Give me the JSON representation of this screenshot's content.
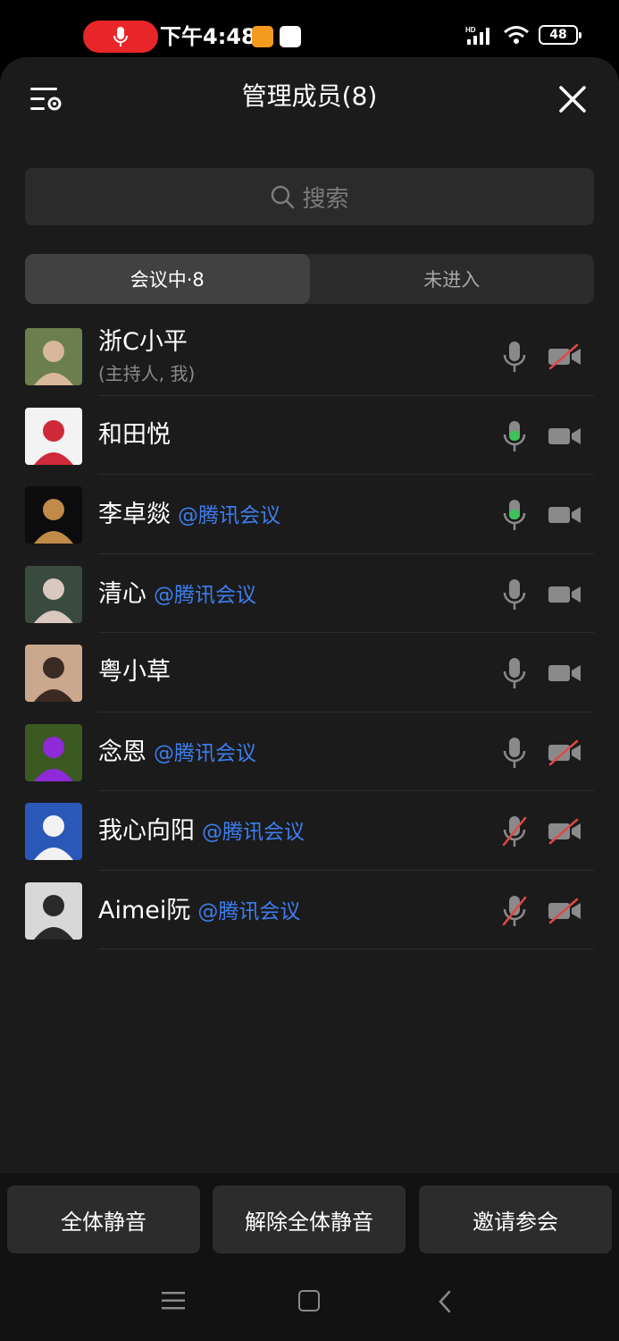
{
  "status_bar": {
    "time": "下午4:48",
    "battery": "48"
  },
  "header": {
    "title": "管理成员(8)"
  },
  "search": {
    "placeholder": "搜索"
  },
  "tabs": [
    {
      "label": "会议中·8",
      "active": true
    },
    {
      "label": "未进入",
      "active": false
    }
  ],
  "members": [
    {
      "name": "浙C小平",
      "tag": "",
      "role": "(主持人, 我)",
      "mic": "idle",
      "camera": "off"
    },
    {
      "name": "和田悦",
      "tag": "",
      "role": "",
      "mic": "speaking",
      "camera": "on"
    },
    {
      "name": "李卓燚",
      "tag": "@腾讯会议",
      "role": "",
      "mic": "speaking",
      "camera": "on"
    },
    {
      "name": "清心",
      "tag": "@腾讯会议",
      "role": "",
      "mic": "idle",
      "camera": "on"
    },
    {
      "name": "粤小草",
      "tag": "",
      "role": "",
      "mic": "idle",
      "camera": "on"
    },
    {
      "name": "念恩",
      "tag": "@腾讯会议",
      "role": "",
      "mic": "idle",
      "camera": "off"
    },
    {
      "name": "我心向阳",
      "tag": "@腾讯会议",
      "role": "",
      "mic": "muted",
      "camera": "off"
    },
    {
      "name": "Aimei阮",
      "tag": "@腾讯会议",
      "role": "",
      "mic": "muted",
      "camera": "off"
    }
  ],
  "actions": {
    "mute_all": "全体静音",
    "unmute_all": "解除全体静音",
    "invite": "邀请参会"
  },
  "colors": {
    "sheet_bg": "#1b1b1b",
    "tag_blue": "#3d7eee",
    "speaking_green": "#3ec05a",
    "muted_red": "#e04848",
    "record_red": "#e8262a"
  }
}
